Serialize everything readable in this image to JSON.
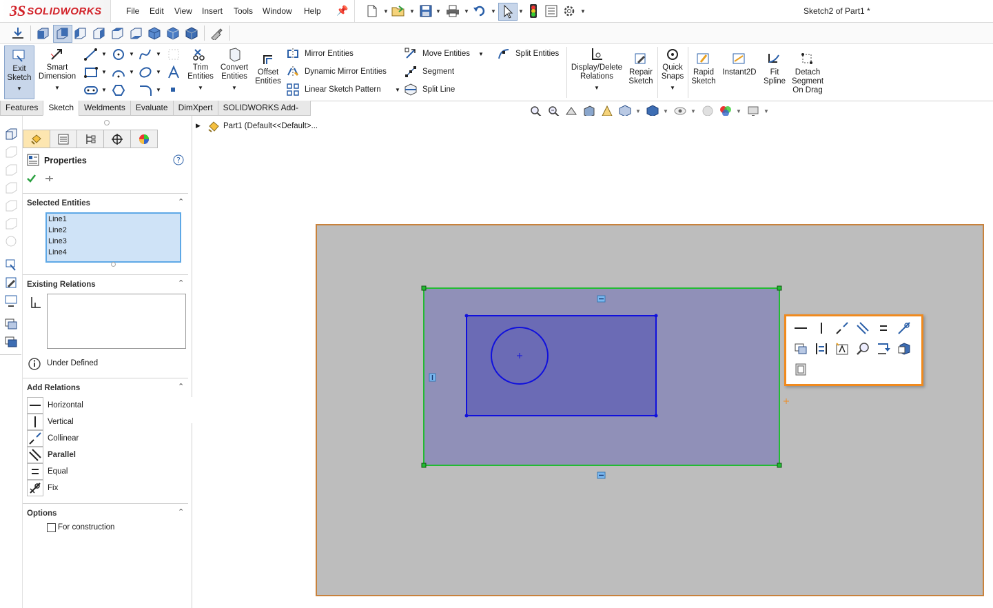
{
  "app": {
    "logo_ds": "3S",
    "logo_text": "SOLIDWORKS",
    "document_title": "Sketch2 of Part1 *"
  },
  "menu": [
    "File",
    "Edit",
    "View",
    "Insert",
    "Tools",
    "Window",
    "Help"
  ],
  "command_manager": {
    "exit_sketch": [
      "Exit",
      "Sketch"
    ],
    "smart_dimension": [
      "Smart",
      "Dimension"
    ],
    "trim_entities": [
      "Trim",
      "Entities"
    ],
    "convert_entities": [
      "Convert",
      "Entities"
    ],
    "offset_entities": [
      "Offset",
      "Entities"
    ],
    "mirror_entities": "Mirror Entities",
    "dynamic_mirror_entities": "Dynamic Mirror Entities",
    "linear_sketch_pattern": "Linear Sketch Pattern",
    "move_entities": "Move Entities",
    "segment": "Segment",
    "split_line": "Split Line",
    "split_entities": "Split Entities",
    "display_delete_relations": [
      "Display/Delete",
      "Relations"
    ],
    "repair_sketch": [
      "Repair",
      "Sketch"
    ],
    "quick_snaps": [
      "Quick",
      "Snaps"
    ],
    "rapid_sketch": [
      "Rapid",
      "Sketch"
    ],
    "instant2d": "Instant2D",
    "fit_spline": [
      "Fit",
      "Spline"
    ],
    "detach_segment": [
      "Detach",
      "Segment",
      "On Drag"
    ]
  },
  "tabs": [
    "Features",
    "Sketch",
    "Weldments",
    "Evaluate",
    "DimXpert",
    "SOLIDWORKS Add-Ins"
  ],
  "active_tab": "Sketch",
  "feature_tree": {
    "root_label": "Part1  (Default<<Default>..."
  },
  "property_manager": {
    "title": "Properties",
    "selected_entities": {
      "header": "Selected Entities",
      "items": [
        "Line1",
        "Line2",
        "Line3",
        "Line4"
      ]
    },
    "existing_relations": {
      "header": "Existing Relations",
      "status": "Under Defined"
    },
    "add_relations": {
      "header": "Add Relations",
      "items": [
        {
          "label": "Horizontal",
          "icon": "horizontal-icon"
        },
        {
          "label": "Vertical",
          "icon": "vertical-icon"
        },
        {
          "label": "Collinear",
          "icon": "collinear-icon"
        },
        {
          "label": "Parallel",
          "icon": "parallel-icon",
          "bold": true
        },
        {
          "label": "Equal",
          "icon": "equal-icon"
        },
        {
          "label": "Fix",
          "icon": "fix-icon"
        }
      ]
    },
    "options": {
      "header": "Options",
      "for_construction": "For construction",
      "for_construction_checked": false
    }
  },
  "colors": {
    "sheet_bg": "#bdbdbd",
    "sheet_border": "#c8823c",
    "outer_rect_fill": "#9090b8",
    "outer_rect_stroke": "#22bb33",
    "inner_rect_fill": "#6b6bb5",
    "inner_rect_stroke": "#1010dd",
    "popup_border": "#f08a1e",
    "selection_bg": "#cfe3f7"
  }
}
